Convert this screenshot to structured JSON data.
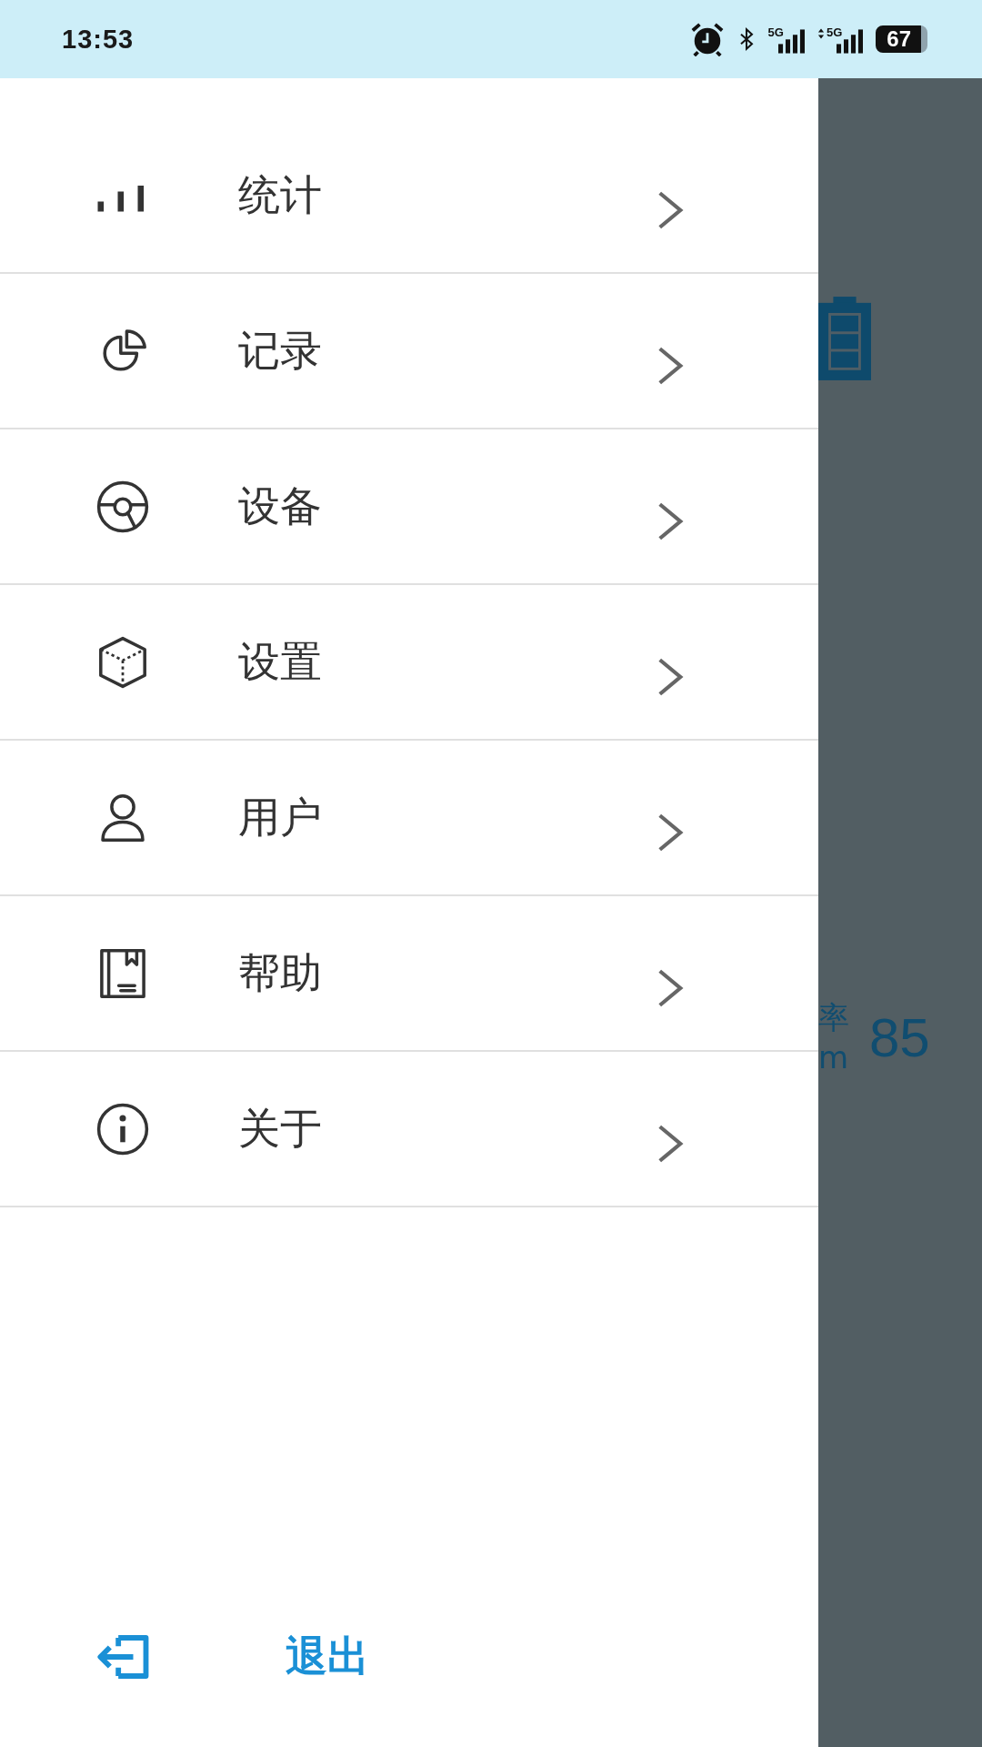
{
  "status_bar": {
    "time": "13:53",
    "network_labels": [
      "5G",
      "5G"
    ],
    "battery": "67"
  },
  "menu": {
    "items": [
      {
        "label": "统计",
        "kind": "stats"
      },
      {
        "label": "记录",
        "kind": "records"
      },
      {
        "label": "设备",
        "kind": "device"
      },
      {
        "label": "设置",
        "kind": "settings"
      },
      {
        "label": "用户",
        "kind": "user"
      },
      {
        "label": "帮助",
        "kind": "help"
      },
      {
        "label": "关于",
        "kind": "about"
      }
    ]
  },
  "logout": {
    "label": "退出"
  },
  "background": {
    "label_1": "率",
    "label_2": "m",
    "value": "85"
  }
}
